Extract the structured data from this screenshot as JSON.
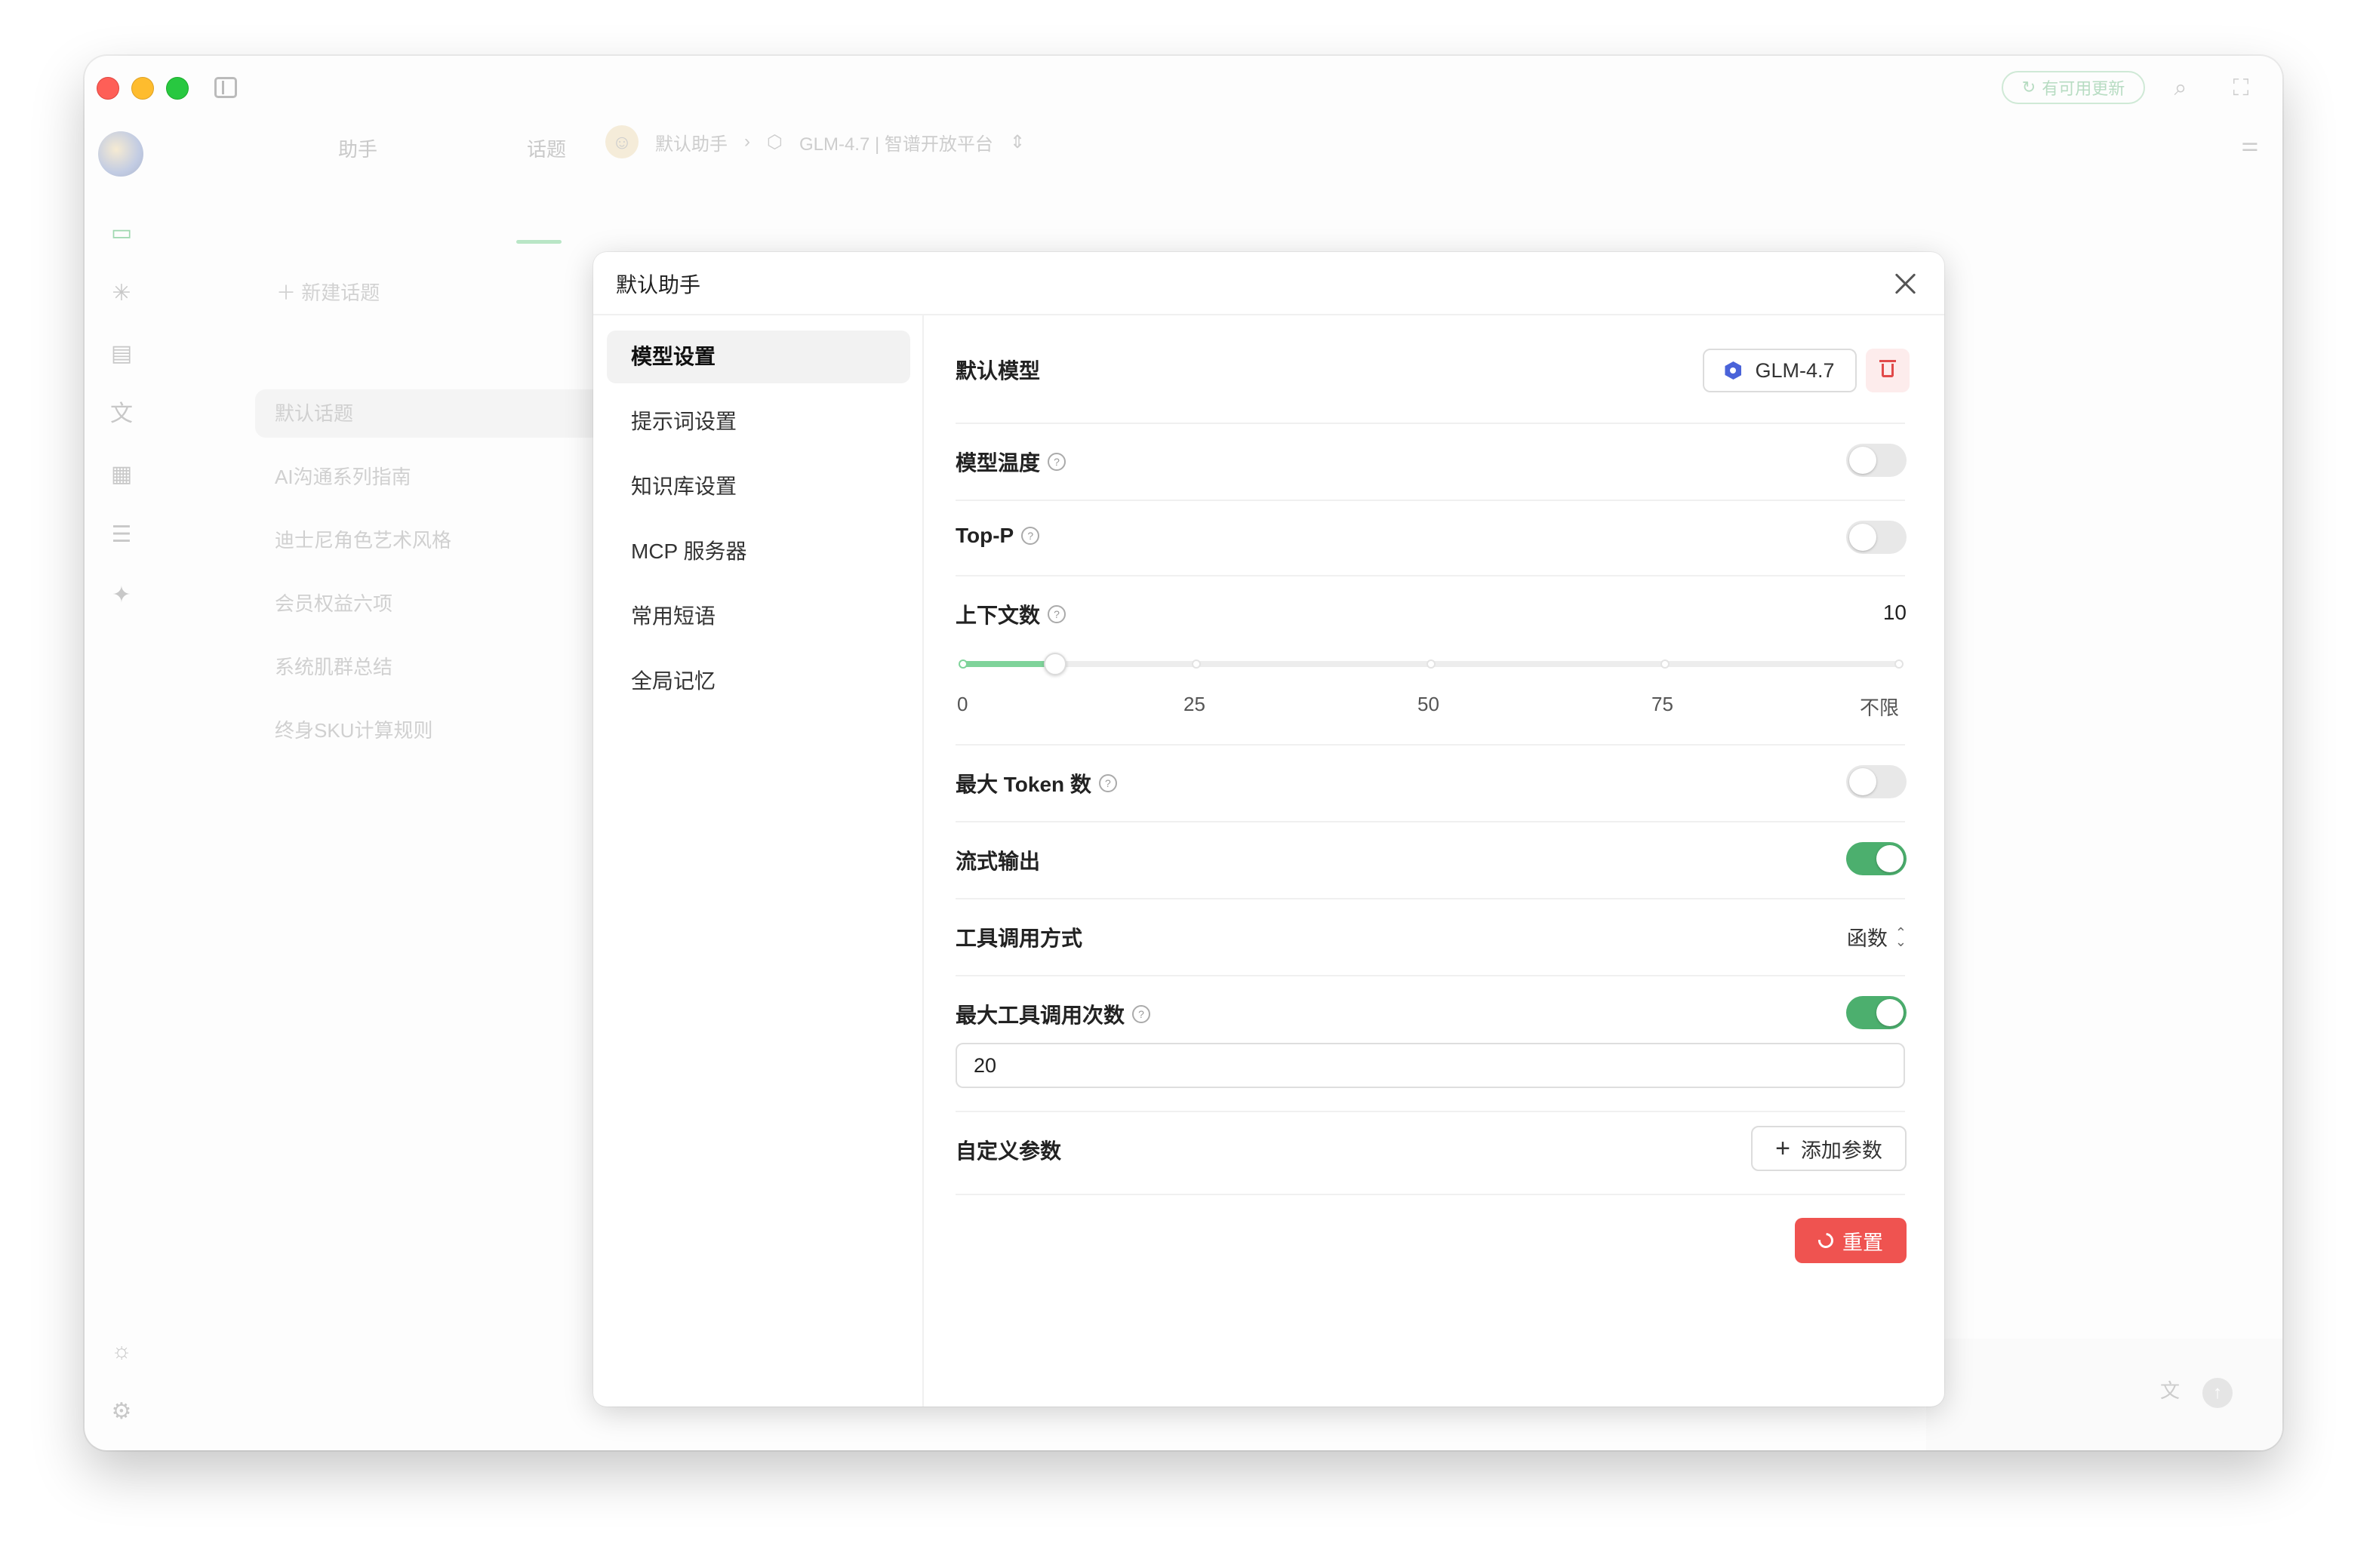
{
  "titlebar": {
    "update_label": "有可用更新"
  },
  "topics_panel": {
    "tabs": [
      {
        "label": "助手"
      },
      {
        "label": "话题"
      }
    ],
    "new_topic": "新建话题",
    "items": [
      {
        "label": "默认话题"
      },
      {
        "label": "AI沟通系列指南"
      },
      {
        "label": "迪士尼角色艺术风格"
      },
      {
        "label": "会员权益六项"
      },
      {
        "label": "系统肌群总结"
      },
      {
        "label": "终身SKU计算规则"
      }
    ]
  },
  "breadcrumb": {
    "assistant": "默认助手",
    "model": "GLM-4.7 | 智谱开放平台"
  },
  "modal": {
    "title": "默认助手",
    "nav": [
      {
        "label": "模型设置"
      },
      {
        "label": "提示词设置"
      },
      {
        "label": "知识库设置"
      },
      {
        "label": "MCP 服务器"
      },
      {
        "label": "常用短语"
      },
      {
        "label": "全局记忆"
      }
    ],
    "settings": {
      "default_model": {
        "label": "默认模型",
        "value": "GLM-4.7"
      },
      "temperature": {
        "label": "模型温度",
        "enabled": false
      },
      "top_p": {
        "label": "Top-P",
        "enabled": false
      },
      "context": {
        "label": "上下文数",
        "value": "10",
        "slider_fraction": 0.1,
        "ticks": [
          "0",
          "25",
          "50",
          "75",
          "不限"
        ]
      },
      "max_tokens": {
        "label": "最大 Token 数",
        "enabled": false
      },
      "stream": {
        "label": "流式输出",
        "enabled": true
      },
      "tool_call": {
        "label": "工具调用方式",
        "value": "函数"
      },
      "max_tool_calls": {
        "label": "最大工具调用次数",
        "enabled": true,
        "value": "20"
      },
      "custom_params": {
        "label": "自定义参数",
        "add_label": "添加参数"
      },
      "reset_label": "重置"
    }
  },
  "colors": {
    "accent": "#4caf6e",
    "danger": "#ef5350",
    "model_icon": "#4a63d9"
  }
}
